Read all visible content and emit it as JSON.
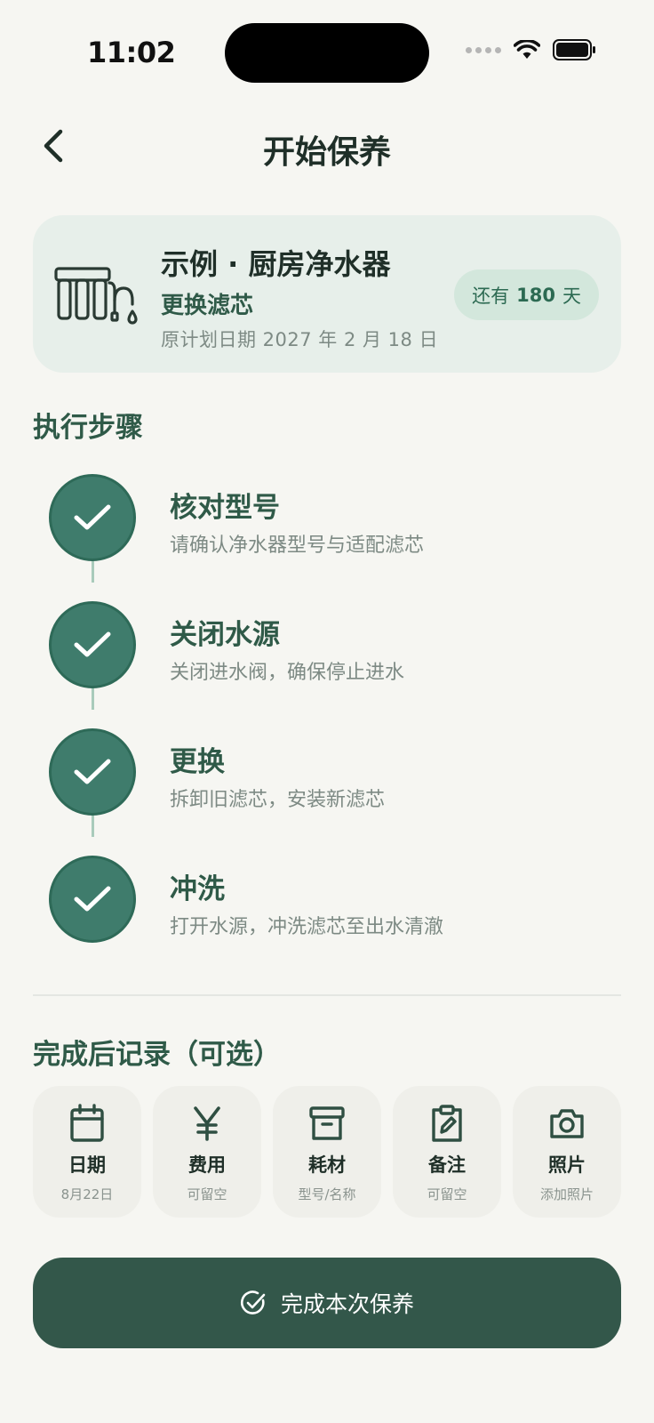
{
  "status_bar": {
    "time": "11:02"
  },
  "header": {
    "title": "开始保养"
  },
  "task": {
    "title": "示例 · 厨房净水器",
    "subtitle": "更换滤芯",
    "planned_date": "原计划日期 2027 年 2 月 18 日",
    "days_prefix": "还有",
    "days_value": "180",
    "days_suffix": "天"
  },
  "steps_section": {
    "title": "执行步骤",
    "steps": [
      {
        "title": "核对型号",
        "desc": "请确认净水器型号与适配滤芯",
        "done": true
      },
      {
        "title": "关闭水源",
        "desc": "关闭进水阀，确保停止进水",
        "done": true
      },
      {
        "title": "更换",
        "desc": "拆卸旧滤芯，安装新滤芯",
        "done": true
      },
      {
        "title": "冲洗",
        "desc": "打开水源，冲洗滤芯至出水清澈",
        "done": true
      }
    ]
  },
  "record_section": {
    "title": "完成后记录（可选）",
    "items": [
      {
        "label": "日期",
        "sub": "8月22日",
        "icon": "calendar-icon"
      },
      {
        "label": "费用",
        "sub": "可留空",
        "icon": "yen-icon"
      },
      {
        "label": "耗材",
        "sub": "型号/名称",
        "icon": "archive-box-icon"
      },
      {
        "label": "备注",
        "sub": "可留空",
        "icon": "clipboard-edit-icon"
      },
      {
        "label": "照片",
        "sub": "添加照片",
        "icon": "camera-icon"
      }
    ]
  },
  "complete_button": {
    "label": "完成本次保养"
  },
  "colors": {
    "background": "#f6f6f2",
    "primary_dark": "#33574a",
    "step_check": "#3f7c6c",
    "card_bg": "#e7efea",
    "badge_bg": "#d3e7dc"
  }
}
